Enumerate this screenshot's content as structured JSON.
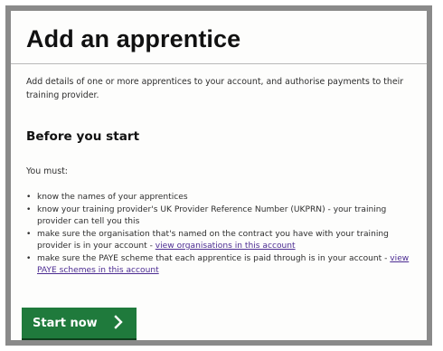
{
  "page": {
    "title": "Add an apprentice",
    "intro": "Add details of one or more apprentices to your account, and authorise payments to their training provider."
  },
  "before_you_start": {
    "heading": "Before you start",
    "you_must": "You must:",
    "items": [
      {
        "text": "know the names of your apprentices",
        "link": ""
      },
      {
        "text": "know your training provider's UK Provider Reference Number (UKPRN) - your training provider can tell you this",
        "link": ""
      },
      {
        "text": "make sure the organisation that's named on the contract you have with your training provider is in your account - ",
        "link": "view organisations in this account"
      },
      {
        "text": "make sure the PAYE scheme that each apprentice is paid through is in your account - ",
        "link": "view PAYE schemes in this account"
      }
    ]
  },
  "start_button": {
    "label": "Start now",
    "icon": "chevron-right-icon"
  },
  "colors": {
    "button_green": "#1f7a3c",
    "link_purple": "#4c2c92",
    "frame_grey": "#8a8a8a"
  }
}
